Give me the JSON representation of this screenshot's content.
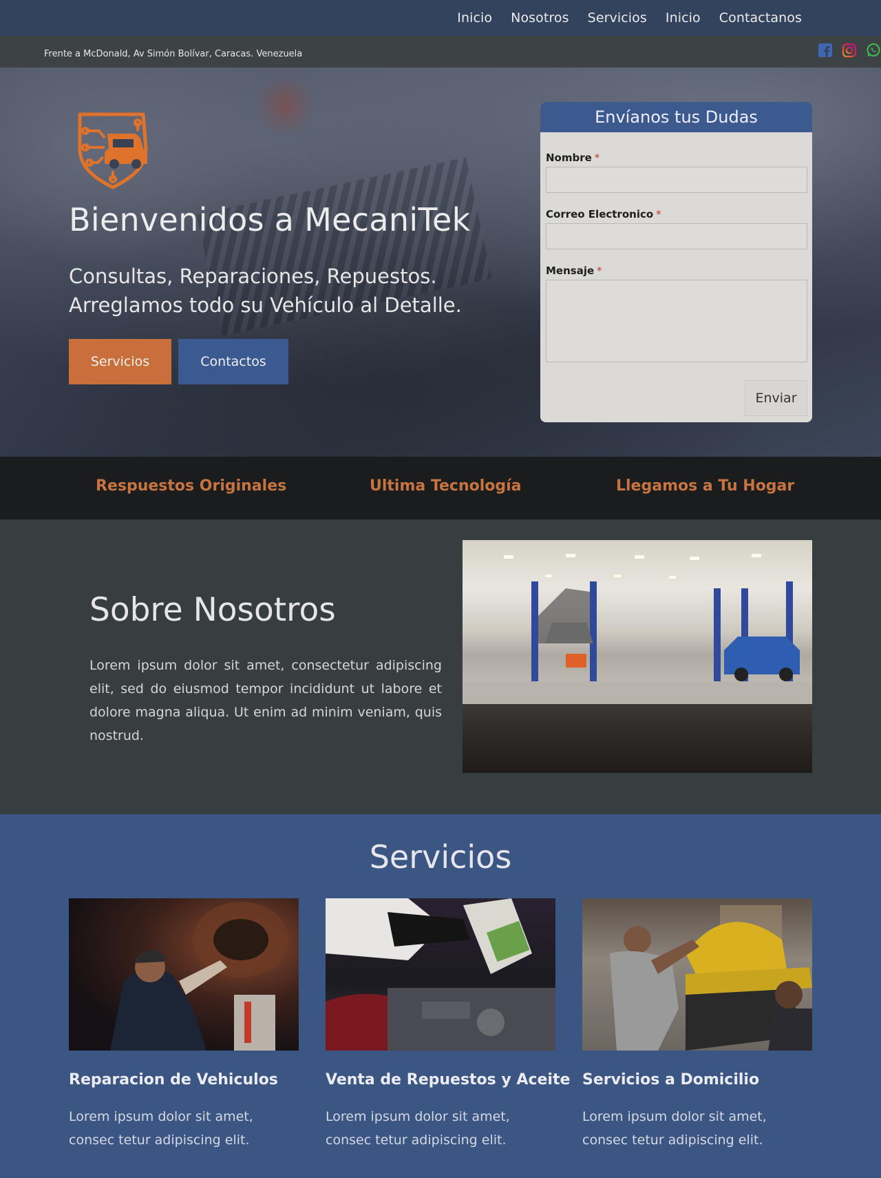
{
  "nav": {
    "items": [
      "Inicio",
      "Nosotros",
      "Servicios",
      "Inicio",
      "Contactanos"
    ]
  },
  "infobar": {
    "address": "Frente a McDonald, Av Simón Bolívar, Caracas. Venezuela",
    "social_icons": [
      "facebook-icon",
      "instagram-icon",
      "whatsapp-icon"
    ]
  },
  "hero": {
    "title": "Bienvenidos a MecaniTek",
    "subtitle": "Consultas, Reparaciones, Repuestos. Arreglamos todo su Vehículo al Detalle.",
    "btn_services": "Servicios",
    "btn_contacts": "Contactos"
  },
  "form": {
    "title": "Envíanos tus Dudas",
    "name_label": "Nombre",
    "email_label": "Correo Electronico",
    "message_label": "Mensaje",
    "required_mark": "*",
    "name_value": "",
    "email_value": "",
    "message_value": "",
    "submit_label": "Enviar"
  },
  "features": [
    "Respuestos Originales",
    "Ultima Tecnología",
    "Llegamos a Tu Hogar"
  ],
  "about": {
    "title": "Sobre Nosotros",
    "text": "Lorem ipsum dolor sit amet, consectetur adipiscing elit, sed do eiusmod tempor incididunt ut labore et dolore magna aliqua. Ut enim ad minim veniam, quis nostrud."
  },
  "services": {
    "title": "Servicios",
    "cards": [
      {
        "title": "Reparacion de Vehiculos",
        "text": "Lorem ipsum dolor sit amet, consec tetur adipiscing elit."
      },
      {
        "title": "Venta de Repuestos y Aceite",
        "text": "Lorem ipsum dolor sit amet, consec tetur adipiscing elit."
      },
      {
        "title": "Servicios a Domicilio",
        "text": "Lorem ipsum dolor sit amet, consec tetur adipiscing elit."
      }
    ]
  },
  "colors": {
    "accent_orange": "#c86f3c",
    "brand_blue": "#3b5a91",
    "nav_bg": "#34435d"
  }
}
